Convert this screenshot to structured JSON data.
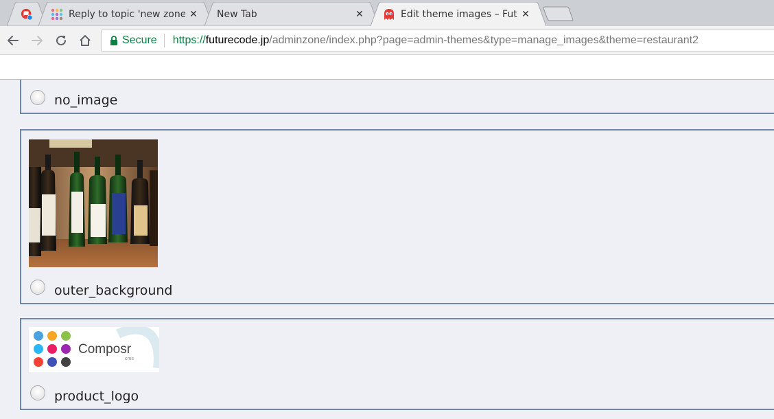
{
  "browser": {
    "tabs": [
      {
        "title": "",
        "icon": "chat-app-icon",
        "active": false
      },
      {
        "title": "Reply to topic 'new zone",
        "icon": "dots-grid-icon",
        "active": false
      },
      {
        "title": "New Tab",
        "icon": "",
        "active": false
      },
      {
        "title": "Edit theme images – Futu",
        "icon": "ghost-icon",
        "active": true
      }
    ],
    "close_glyph": "✕",
    "address": {
      "secure_label": "Secure",
      "scheme": "https://",
      "host": "futurecode.jp",
      "path": "/adminzone/index.php?page=admin-themes&type=manage_images&theme=restaurant2"
    }
  },
  "images": [
    {
      "name": "no_image"
    },
    {
      "name": "outer_background"
    },
    {
      "name": "product_logo",
      "logo_text": "Composr",
      "logo_sub": "cms"
    }
  ],
  "colors": {
    "tab_active": "#f2f2f2",
    "tab_inactive": "#dfe1e5",
    "secure_green": "#0b8043",
    "box_border": "#6e86a8",
    "page_bg": "#eff0f6"
  }
}
